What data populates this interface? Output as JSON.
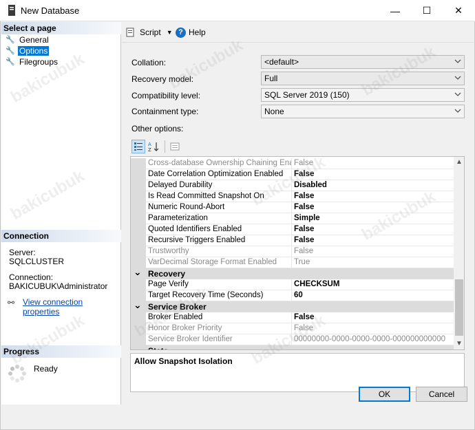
{
  "window": {
    "title": "New Database",
    "controls": {
      "minimize": "—",
      "maximize": "☐",
      "close": "✕"
    }
  },
  "left_panel": {
    "select_page_header": "Select a page",
    "pages": [
      {
        "label": "General",
        "selected": false
      },
      {
        "label": "Options",
        "selected": true
      },
      {
        "label": "Filegroups",
        "selected": false
      }
    ],
    "connection_header": "Connection",
    "server_label": "Server:",
    "server_value": "SQLCLUSTER",
    "connection_label": "Connection:",
    "connection_value": "BAKICUBUK\\Administrator",
    "view_connection_link": "View connection properties",
    "progress_header": "Progress",
    "progress_status": "Ready"
  },
  "toolbar": {
    "script_label": "Script",
    "help_label": "Help"
  },
  "form": {
    "collation": {
      "label": "Collation:",
      "value": "<default>"
    },
    "recovery_model": {
      "label": "Recovery model:",
      "value": "Full"
    },
    "compatibility_level": {
      "label": "Compatibility level:",
      "value": "SQL Server 2019 (150)"
    },
    "containment_type": {
      "label": "Containment type:",
      "value": "None"
    },
    "other_options_label": "Other options:"
  },
  "grid": {
    "rows": [
      {
        "name": "Cross-database Ownership Chaining Enabled",
        "value": "False",
        "bold": false,
        "dim": true
      },
      {
        "name": "Date Correlation Optimization Enabled",
        "value": "False",
        "bold": true,
        "dim": false
      },
      {
        "name": "Delayed Durability",
        "value": "Disabled",
        "bold": true,
        "dim": false
      },
      {
        "name": "Is Read Committed Snapshot On",
        "value": "False",
        "bold": true,
        "dim": false
      },
      {
        "name": "Numeric Round-Abort",
        "value": "False",
        "bold": true,
        "dim": false
      },
      {
        "name": "Parameterization",
        "value": "Simple",
        "bold": true,
        "dim": false
      },
      {
        "name": "Quoted Identifiers Enabled",
        "value": "False",
        "bold": true,
        "dim": false
      },
      {
        "name": "Recursive Triggers Enabled",
        "value": "False",
        "bold": true,
        "dim": false
      },
      {
        "name": "Trustworthy",
        "value": "False",
        "bold": false,
        "dim": true
      },
      {
        "name": "VarDecimal Storage Format Enabled",
        "value": "True",
        "bold": false,
        "dim": true
      }
    ],
    "recovery_category": "Recovery",
    "recovery_rows": [
      {
        "name": "Page Verify",
        "value": "CHECKSUM",
        "bold": true,
        "dim": false
      },
      {
        "name": "Target Recovery Time (Seconds)",
        "value": "60",
        "bold": true,
        "dim": false
      }
    ],
    "service_broker_category": "Service Broker",
    "service_broker_rows": [
      {
        "name": "Broker Enabled",
        "value": "False",
        "bold": true,
        "dim": false
      },
      {
        "name": "Honor Broker Priority",
        "value": "False",
        "bold": false,
        "dim": true
      },
      {
        "name": "Service Broker Identifier",
        "value": "00000000-0000-0000-0000-000000000000",
        "bold": false,
        "dim": true
      }
    ],
    "state_category": "State"
  },
  "description": "Allow Snapshot Isolation",
  "buttons": {
    "ok": "OK",
    "cancel": "Cancel"
  },
  "watermark_text": "bakicubuk"
}
